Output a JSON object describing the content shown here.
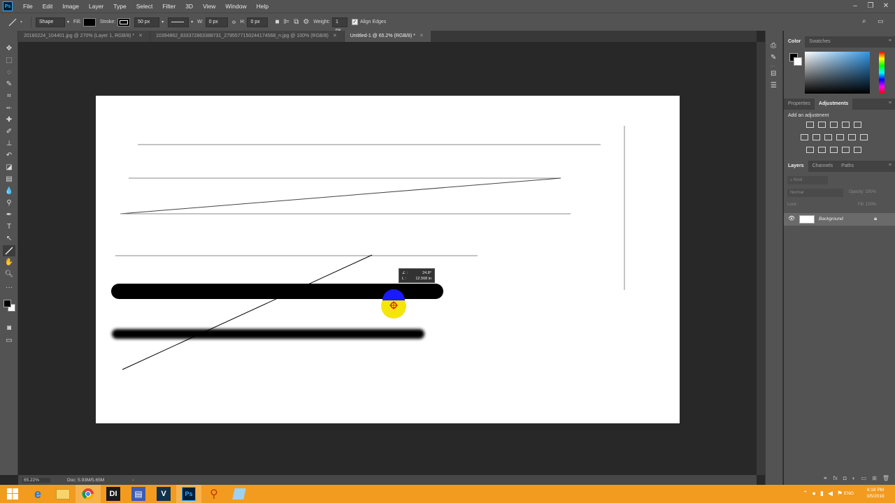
{
  "app": {
    "logo_text": "Ps",
    "menu": [
      "File",
      "Edit",
      "Image",
      "Layer",
      "Type",
      "Select",
      "Filter",
      "3D",
      "View",
      "Window",
      "Help"
    ]
  },
  "options_bar": {
    "mode": "Shape",
    "fill_label": "Fill:",
    "stroke_label": "Stroke:",
    "stroke_width": "50 px",
    "w_label": "W:",
    "w_value": "0 px",
    "h_label": "H:",
    "h_value": "0 px",
    "weight_label": "Weight:",
    "weight_value": "1 px",
    "align_edges": "Align Edges",
    "align_edges_checked": true
  },
  "tabs": [
    {
      "label": "20180224_104401.jpg @ 270% (Layer 1, RGB/8) *",
      "active": false
    },
    {
      "label": "10394862_833372863388731_2795577150244174568_n.jpg @ 100% (RGB/8)",
      "active": false
    },
    {
      "label": "Untitled-1 @ 65.2% (RGB/8) *",
      "active": true
    }
  ],
  "tooltip": {
    "angle_label": "∠ :",
    "angle_value": "24.8°",
    "length_label": "L :",
    "length_value": "12.568 in"
  },
  "status": {
    "zoom": "65.22%",
    "doc": "Doc: 5.93M/5.65M"
  },
  "color_panel": {
    "tabs": [
      "Color",
      "Swatches"
    ],
    "fg_color": "#000000",
    "bg_color": "#ffffff"
  },
  "adjustments_panel": {
    "tabs": [
      "Properties",
      "Adjustments"
    ],
    "heading": "Add an adjustment"
  },
  "layers_panel": {
    "tabs": [
      "Layers",
      "Channels",
      "Paths"
    ],
    "kind_label": "Kind",
    "blend_mode": "Normal",
    "opacity_label": "Opacity:",
    "opacity_value": "100%",
    "lock_label": "Lock:",
    "fill_label": "Fill:",
    "fill_value": "100%",
    "layer_name": "Background"
  },
  "taskbar": {
    "clock_time": "6:18 PM",
    "clock_date": "3/5/2018",
    "lang": "ENG",
    "app_labels": [
      "DI",
      "V",
      "Ps"
    ]
  },
  "colors": {
    "ui_bg": "#535353",
    "work_bg": "#282828",
    "taskbar": "#f29b1f",
    "cursor_highlight": "#f5e60a",
    "cursor_dot": "#1a1aff"
  }
}
